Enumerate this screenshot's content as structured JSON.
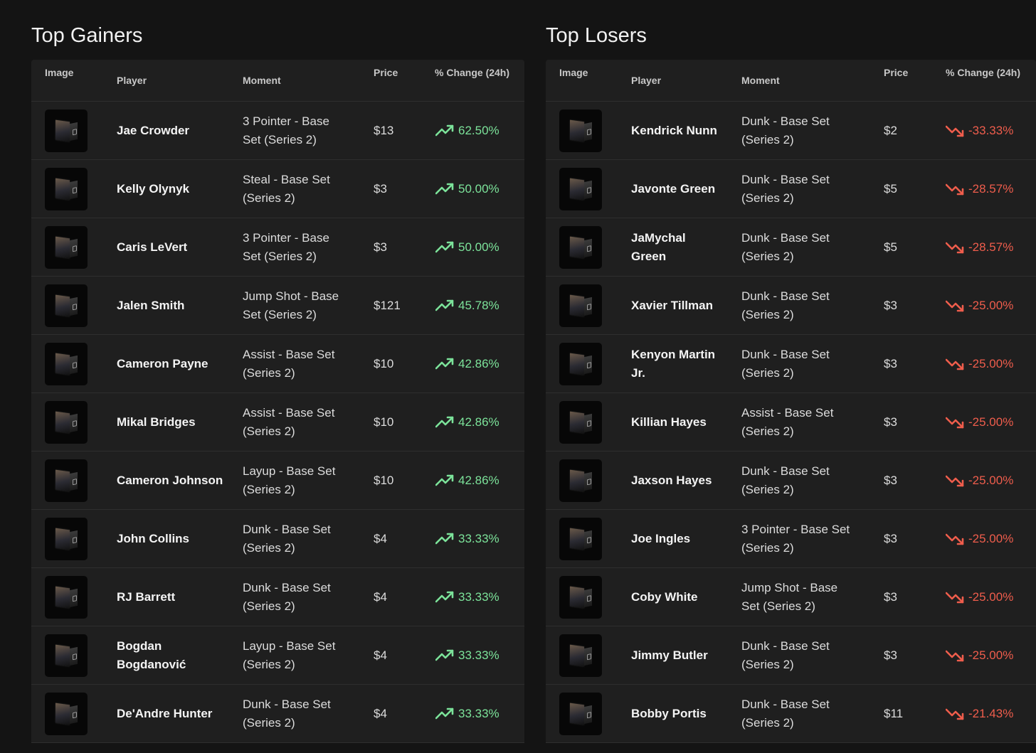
{
  "headers": {
    "image": "Image",
    "player": "Player",
    "moment": "Moment",
    "price": "Price",
    "change": "% Change (24h)"
  },
  "colors": {
    "gain": "#7ce39a",
    "loss": "#ef5d4c",
    "panel_bg": "#1f1f1f",
    "page_bg": "#141414"
  },
  "icons": {
    "gain": "trending-up-icon",
    "loss": "trending-down-icon",
    "thumbnail": "moment-thumbnail"
  },
  "gainers": {
    "title": "Top Gainers",
    "rows": [
      {
        "player": "Jae Crowder",
        "moment": "3 Pointer - Base Set (Series 2)",
        "price": "$13",
        "change": "62.50%"
      },
      {
        "player": "Kelly Olynyk",
        "moment": "Steal - Base Set (Series 2)",
        "price": "$3",
        "change": "50.00%"
      },
      {
        "player": "Caris LeVert",
        "moment": "3 Pointer - Base Set (Series 2)",
        "price": "$3",
        "change": "50.00%"
      },
      {
        "player": "Jalen Smith",
        "moment": "Jump Shot - Base Set (Series 2)",
        "price": "$121",
        "change": "45.78%"
      },
      {
        "player": "Cameron Payne",
        "moment": "Assist - Base Set (Series 2)",
        "price": "$10",
        "change": "42.86%"
      },
      {
        "player": "Mikal Bridges",
        "moment": "Assist - Base Set (Series 2)",
        "price": "$10",
        "change": "42.86%"
      },
      {
        "player": "Cameron Johnson",
        "moment": "Layup - Base Set (Series 2)",
        "price": "$10",
        "change": "42.86%"
      },
      {
        "player": "John Collins",
        "moment": "Dunk - Base Set (Series 2)",
        "price": "$4",
        "change": "33.33%"
      },
      {
        "player": "RJ Barrett",
        "moment": "Dunk - Base Set (Series 2)",
        "price": "$4",
        "change": "33.33%"
      },
      {
        "player": "Bogdan Bogdanović",
        "moment": "Layup - Base Set (Series 2)",
        "price": "$4",
        "change": "33.33%"
      },
      {
        "player": "De'Andre Hunter",
        "moment": "Dunk - Base Set (Series 2)",
        "price": "$4",
        "change": "33.33%"
      }
    ]
  },
  "losers": {
    "title": "Top Losers",
    "rows": [
      {
        "player": "Kendrick Nunn",
        "moment": "Dunk - Base Set (Series 2)",
        "price": "$2",
        "change": "-33.33%"
      },
      {
        "player": "Javonte Green",
        "moment": "Dunk - Base Set (Series 2)",
        "price": "$5",
        "change": "-28.57%"
      },
      {
        "player": "JaMychal Green",
        "moment": "Dunk - Base Set (Series 2)",
        "price": "$5",
        "change": "-28.57%"
      },
      {
        "player": "Xavier Tillman",
        "moment": "Dunk - Base Set (Series 2)",
        "price": "$3",
        "change": "-25.00%"
      },
      {
        "player": "Kenyon Martin Jr.",
        "moment": "Dunk - Base Set (Series 2)",
        "price": "$3",
        "change": "-25.00%"
      },
      {
        "player": "Killian Hayes",
        "moment": "Assist - Base Set (Series 2)",
        "price": "$3",
        "change": "-25.00%"
      },
      {
        "player": "Jaxson Hayes",
        "moment": "Dunk - Base Set (Series 2)",
        "price": "$3",
        "change": "-25.00%"
      },
      {
        "player": "Joe Ingles",
        "moment": "3 Pointer - Base Set (Series 2)",
        "price": "$3",
        "change": "-25.00%"
      },
      {
        "player": "Coby White",
        "moment": "Jump Shot - Base Set (Series 2)",
        "price": "$3",
        "change": "-25.00%"
      },
      {
        "player": "Jimmy Butler",
        "moment": "Dunk - Base Set (Series 2)",
        "price": "$3",
        "change": "-25.00%"
      },
      {
        "player": "Bobby Portis",
        "moment": "Dunk - Base Set (Series 2)",
        "price": "$11",
        "change": "-21.43%"
      }
    ]
  }
}
